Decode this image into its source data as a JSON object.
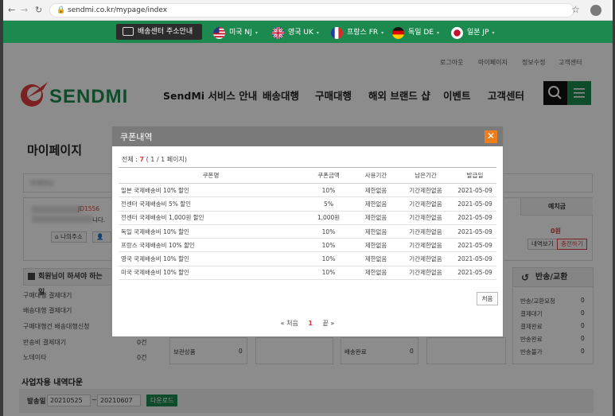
{
  "browser": {
    "url": "sendmi.co.kr/mypage/index"
  },
  "country_bar": {
    "guide": "배송센터 주소안내",
    "countries": [
      {
        "label": "미국 NJ",
        "flag": "us-flag-icon"
      },
      {
        "label": "영국 UK",
        "flag": "uk-flag-icon"
      },
      {
        "label": "프랑스 FR",
        "flag": "fr-flag-icon"
      },
      {
        "label": "독일 DE",
        "flag": "de-flag-icon"
      },
      {
        "label": "일본 JP",
        "flag": "jp-flag-icon"
      }
    ]
  },
  "header": {
    "top_links": [
      "로그아웃",
      "마이페이지",
      "정보수정",
      "고객센터"
    ],
    "logo": "SENDMI",
    "nav": [
      "SendMi 서비스 안내",
      "배송대행",
      "구매대행",
      "해외 브랜드 샵",
      "이벤트",
      "고객센터"
    ]
  },
  "page": {
    "title": "마이페이지",
    "user_name": "박재현님",
    "user_code": "JD1556",
    "user_suffix": "니다.",
    "my_address_btn": "나의주소",
    "deposit": {
      "header": "예치금",
      "amount": "0원",
      "view_btn": "내역보기",
      "charge_btn": "충전하기"
    },
    "todo": {
      "header": "회원님이 하셔야 하는 일",
      "items": [
        {
          "label": "구매대행 결제대기",
          "count": ""
        },
        {
          "label": "배송대행 결제대기",
          "count": ""
        },
        {
          "label": "구매대행건 배송대행신청",
          "count": ""
        },
        {
          "label": "반송비 결제대기",
          "count": "0건"
        },
        {
          "label": "노데이타",
          "count": "0건"
        }
      ]
    },
    "return_panel": {
      "header": "반송/교환",
      "items": [
        {
          "label": "반송/교환요청",
          "count": "0"
        },
        {
          "label": "결제대기",
          "count": "0"
        },
        {
          "label": "결제완료",
          "count": "0"
        },
        {
          "label": "반송완료",
          "count": "0"
        },
        {
          "label": "반송불가",
          "count": "0"
        }
      ]
    },
    "status_fragments": [
      "보관상품",
      "0",
      "배송완료",
      "0"
    ],
    "business_heading": "사업자용 내역다운",
    "ship_date_label": "발송일",
    "date_from": "20210525",
    "date_to": "20210607",
    "download_btn": "다운로드"
  },
  "modal": {
    "title": "쿠폰내역",
    "total_label": "전체 :",
    "total_count": "7",
    "total_pages": "( 1 / 1 페이지)",
    "columns": [
      "쿠폰명",
      "쿠폰금액",
      "사용기간",
      "남은기간",
      "발급일"
    ],
    "rows": [
      [
        "일본 국제배송비 10% 할인",
        "10%",
        "제한없음",
        "기간제한없음",
        "2021-05-09"
      ],
      [
        "전센터 국제배송비 5% 할인",
        "5%",
        "제한없음",
        "기간제한없음",
        "2021-05-09"
      ],
      [
        "전센터 국제배송비 1,000원 할인",
        "1,000원",
        "제한없음",
        "기간제한없음",
        "2021-05-09"
      ],
      [
        "독일 국제배송비 10% 할인",
        "10%",
        "제한없음",
        "기간제한없음",
        "2021-05-09"
      ],
      [
        "프랑스 국제배송비 10% 할인",
        "10%",
        "제한없음",
        "기간제한없음",
        "2021-05-09"
      ],
      [
        "영국 국제배송비 10% 할인",
        "10%",
        "제한없음",
        "기간제한없음",
        "2021-05-09"
      ],
      [
        "미국 국제배송비 10% 할인",
        "10%",
        "제한없음",
        "기간제한없음",
        "2021-05-09"
      ]
    ],
    "first_btn": "처음",
    "pager": {
      "first": "« 처음",
      "current": "1",
      "last": "끝 »"
    }
  },
  "colors": {
    "brand_green": "#1c8a4f",
    "accent_orange": "#ee7d1e",
    "accent_red": "#e13c3c"
  }
}
